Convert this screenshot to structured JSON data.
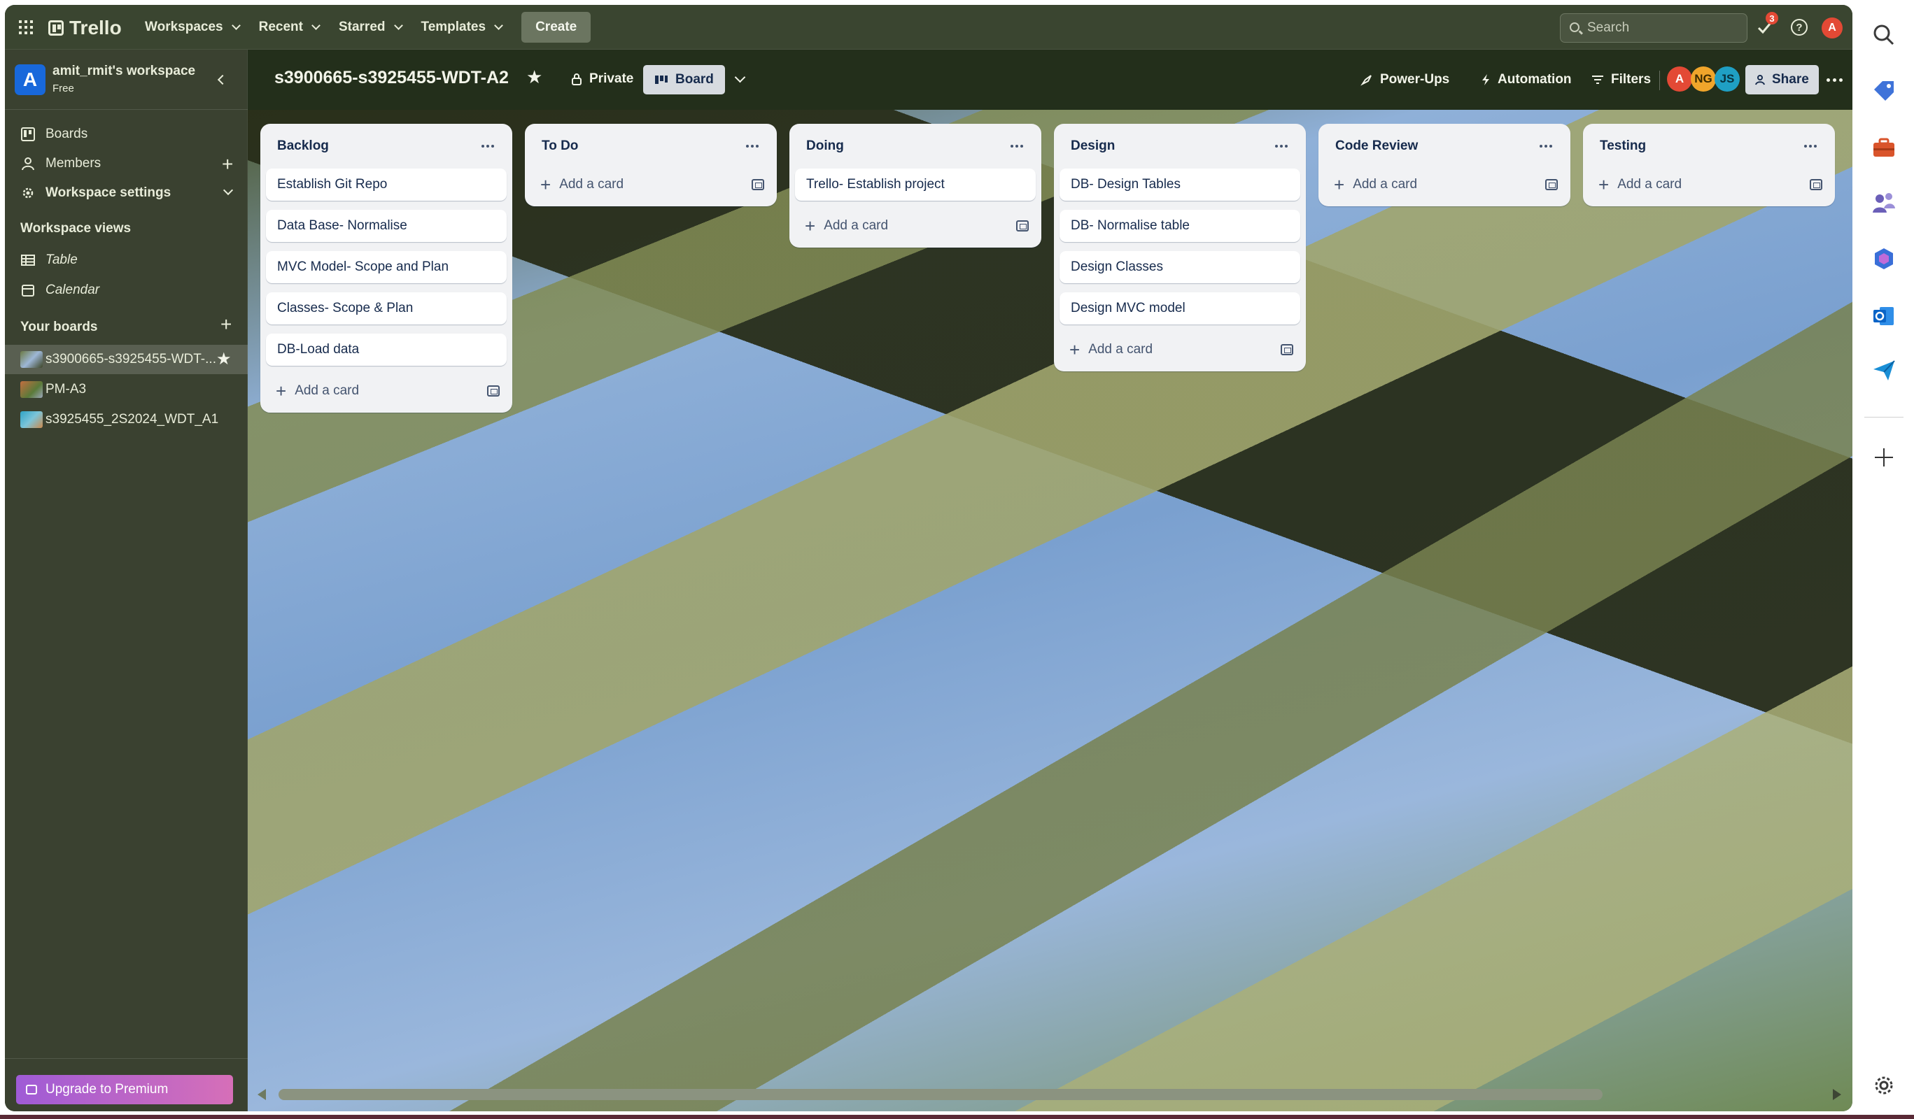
{
  "topnav": {
    "app_name": "Trello",
    "menus": [
      "Workspaces",
      "Recent",
      "Starred",
      "Templates"
    ],
    "create_label": "Create",
    "search_placeholder": "Search",
    "notification_count": "3",
    "avatar_initial": "A"
  },
  "sidebar": {
    "workspace_initial": "A",
    "workspace_name": "amit_rmit's workspace",
    "workspace_plan": "Free",
    "items": [
      {
        "label": "Boards"
      },
      {
        "label": "Members"
      },
      {
        "label": "Workspace settings"
      }
    ],
    "views_heading": "Workspace views",
    "views": [
      {
        "label": "Table"
      },
      {
        "label": "Calendar"
      }
    ],
    "boards_heading": "Your boards",
    "boards": [
      {
        "label": "s3900665-s3925455-WDT-..."
      },
      {
        "label": "PM-A3"
      },
      {
        "label": "s3925455_2S2024_WDT_A1"
      }
    ],
    "upgrade_label": "Upgrade to Premium"
  },
  "board": {
    "title": "s3900665-s3925455-WDT-A2",
    "visibility": "Private",
    "view_label": "Board",
    "powerups_label": "Power-Ups",
    "automation_label": "Automation",
    "filters_label": "Filters",
    "share_label": "Share",
    "members": [
      {
        "initials": "A",
        "color": "#e34935"
      },
      {
        "initials": "NG",
        "color": "#f0a52b"
      },
      {
        "initials": "JS",
        "color": "#1f9fc4"
      }
    ]
  },
  "lists": [
    {
      "title": "Backlog",
      "cards": [
        "Establish Git Repo",
        "Data Base- Normalise",
        "MVC Model- Scope and Plan",
        "Classes- Scope & Plan",
        "DB-Load data"
      ],
      "add_label": "Add a card"
    },
    {
      "title": "To Do",
      "cards": [],
      "add_label": "Add a card"
    },
    {
      "title": "Doing",
      "cards": [
        "Trello- Establish project"
      ],
      "add_label": "Add a card"
    },
    {
      "title": "Design",
      "cards": [
        "DB- Design Tables",
        "DB- Normalise table",
        "Design Classes",
        "Design MVC model"
      ],
      "add_label": "Add a card"
    },
    {
      "title": "Code Review",
      "cards": [],
      "add_label": "Add a card"
    },
    {
      "title": "Testing",
      "cards": [],
      "add_label": "Add a card"
    }
  ],
  "colors": {
    "accent_purple": "#9f5bd6",
    "brand_blue": "#1868db",
    "notification_red": "#e34935"
  }
}
